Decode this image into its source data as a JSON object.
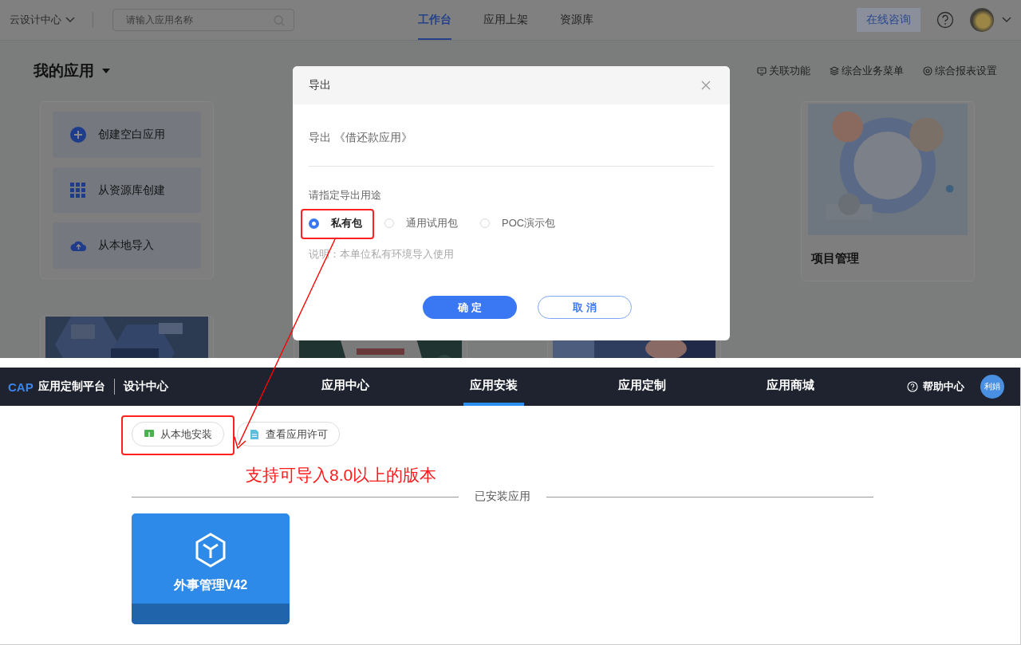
{
  "top_screen": {
    "header": {
      "workspace": "云设计中心",
      "search": {
        "placeholder": "请输入应用名称"
      },
      "tabs": [
        {
          "label": "工作台",
          "selected": true
        },
        {
          "label": "应用上架",
          "selected": false
        },
        {
          "label": "资源库",
          "selected": false
        }
      ],
      "consult_button": "在线咨询"
    },
    "page_title": "我的应用",
    "toolbar_links": [
      "关联功能",
      "综合业务菜单",
      "综合报表设置"
    ],
    "create_actions": [
      "创建空白应用",
      "从资源库创建",
      "从本地导入"
    ],
    "app_cards": [
      {
        "title": "项目管理"
      }
    ],
    "dialog": {
      "title": "导出",
      "subject": "导出 《借还款应用》",
      "purpose_label": "请指定导出用途",
      "options": [
        {
          "label": "私有包",
          "selected": true
        },
        {
          "label": "通用试用包",
          "selected": false
        },
        {
          "label": "POC演示包",
          "selected": false
        }
      ],
      "note": "说明：本单位私有环境导入使用",
      "buttons": [
        {
          "label": "确 定",
          "kind": "primary"
        },
        {
          "label": "取 消",
          "kind": "secondary"
        }
      ]
    }
  },
  "bottom_screen": {
    "header": {
      "brand": "CAP",
      "platform": "应用定制平台",
      "section": "设计中心",
      "tabs": [
        {
          "label": "应用中心",
          "selected": false
        },
        {
          "label": "应用安装",
          "selected": true
        },
        {
          "label": "应用定制",
          "selected": false
        },
        {
          "label": "应用商城",
          "selected": false
        }
      ],
      "help": "帮助中心",
      "avatar": "利娟"
    },
    "actions": [
      "从本地安装",
      "查看应用许可"
    ],
    "section_title": "已安装应用",
    "apps": [
      {
        "title": "外事管理V42"
      }
    ]
  },
  "annotation": {
    "note": "支持可导入8.0以上的版本"
  }
}
